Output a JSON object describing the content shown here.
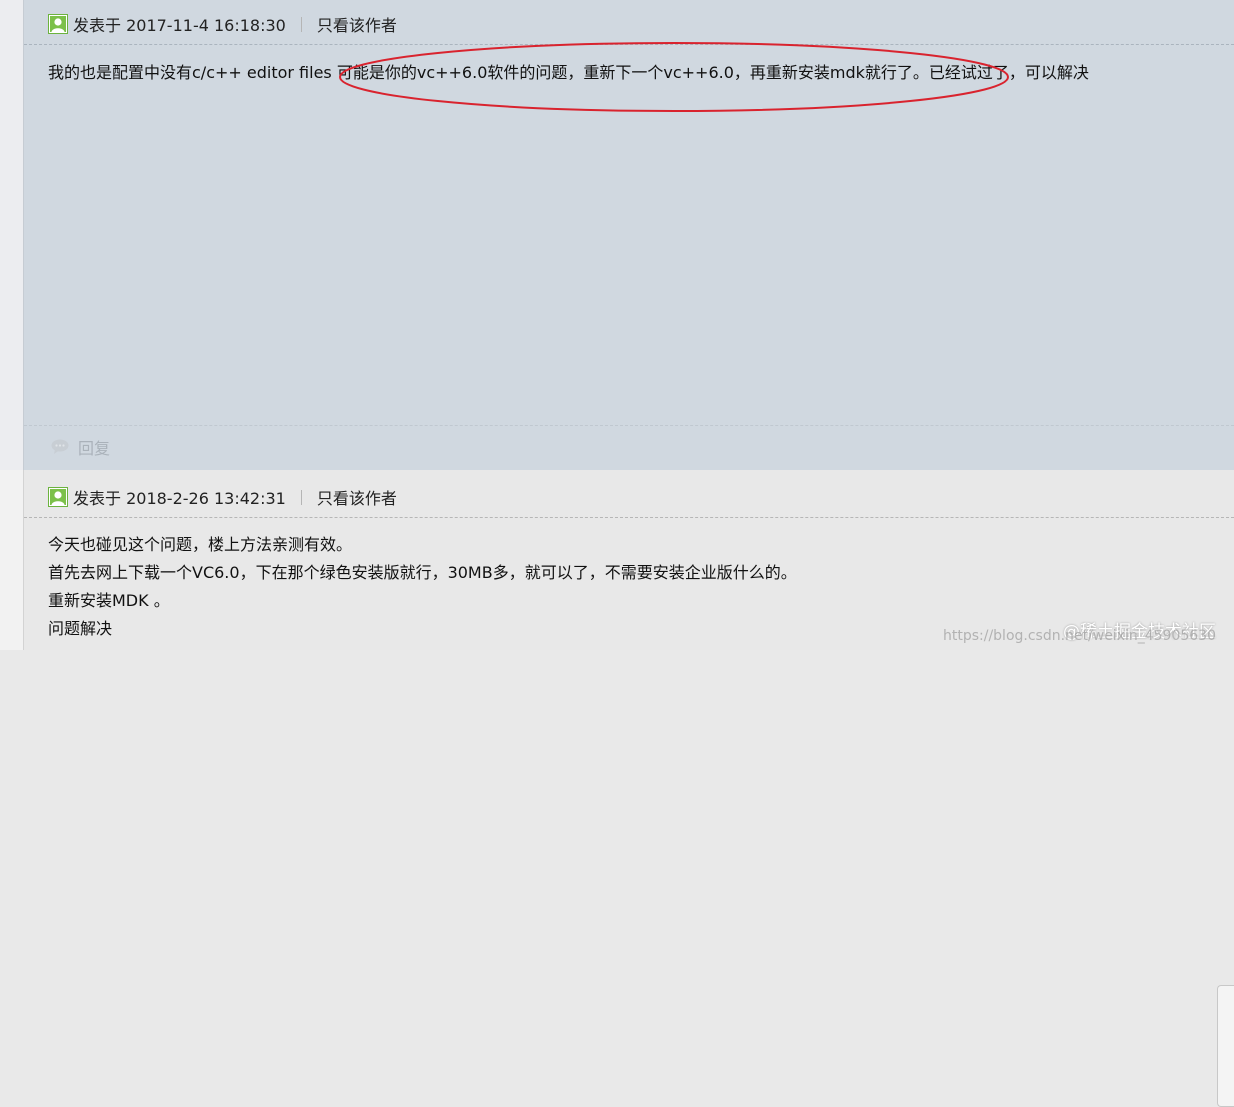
{
  "posts": [
    {
      "timestamp": "发表于 2017-11-4 16:18:30",
      "author_filter": "只看该作者",
      "lines": [
        "我的也是配置中没有c/c++ editor files 可能是你的vc++6.0软件的问题，重新下一个vc++6.0，再重新安装mdk就行了。已经试过了，可以解决"
      ],
      "reply_label": "回复"
    },
    {
      "timestamp": "发表于 2018-2-26 13:42:31",
      "author_filter": "只看该作者",
      "lines": [
        "今天也碰见这个问题，楼上方法亲测有效。",
        "首先去网上下载一个VC6.0，下在那个绿色安装版就行，30MB多，就可以了，不需要安装企业版什么的。",
        "重新安装MDK 。",
        "问题解决"
      ]
    }
  ],
  "watermark": {
    "brand": "@稀土掘金技术社区",
    "url": "https://blog.csdn.net/weixin_45905630"
  },
  "icons": {
    "user": "user-icon",
    "reply": "reply-icon"
  },
  "colors": {
    "post1_background": "#d0d8e0",
    "post2_background": "#e8e8e8",
    "annotation_red": "#d9232e",
    "user_icon_green": "#6cb33f"
  }
}
